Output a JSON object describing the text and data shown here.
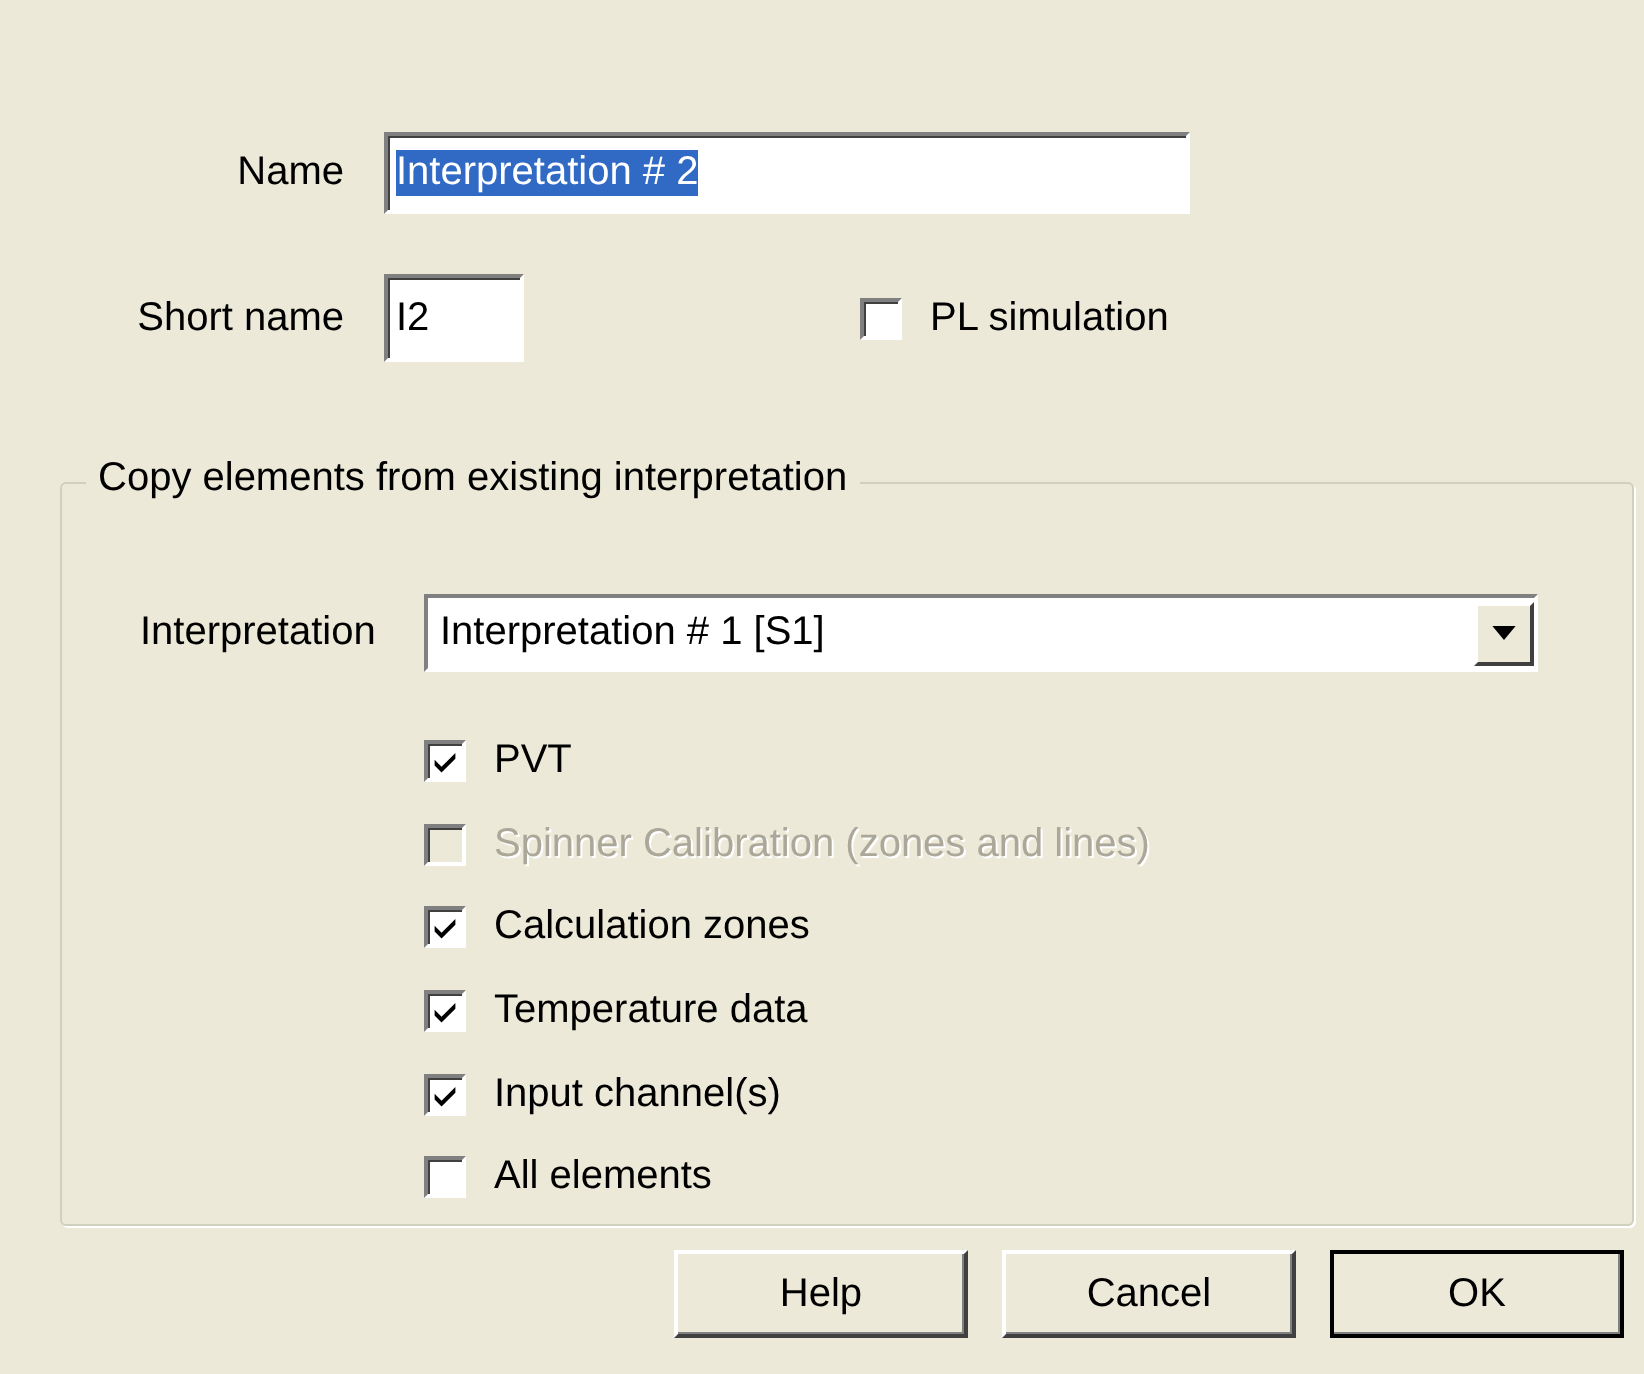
{
  "name_field": {
    "label": "Name",
    "value": "Interpretation # 2",
    "selected_text": true
  },
  "short_name_field": {
    "label": "Short name",
    "value": "I2"
  },
  "pl_simulation": {
    "label": "PL simulation",
    "checked": false,
    "disabled": false
  },
  "copy_group": {
    "title": "Copy elements from existing interpretation",
    "interpretation": {
      "label": "Interpretation",
      "value": "Interpretation # 1 [S1]"
    },
    "options": [
      {
        "label": "PVT",
        "checked": true,
        "disabled": false
      },
      {
        "label": "Spinner Calibration (zones and lines)",
        "checked": false,
        "disabled": true
      },
      {
        "label": "Calculation zones",
        "checked": true,
        "disabled": false
      },
      {
        "label": "Temperature data",
        "checked": true,
        "disabled": false
      },
      {
        "label": "Input channel(s)",
        "checked": true,
        "disabled": false
      },
      {
        "label": "All elements",
        "checked": false,
        "disabled": false
      }
    ]
  },
  "buttons": [
    {
      "label": "Help",
      "default": false
    },
    {
      "label": "Cancel",
      "default": false
    },
    {
      "label": "OK",
      "default": true
    }
  ]
}
